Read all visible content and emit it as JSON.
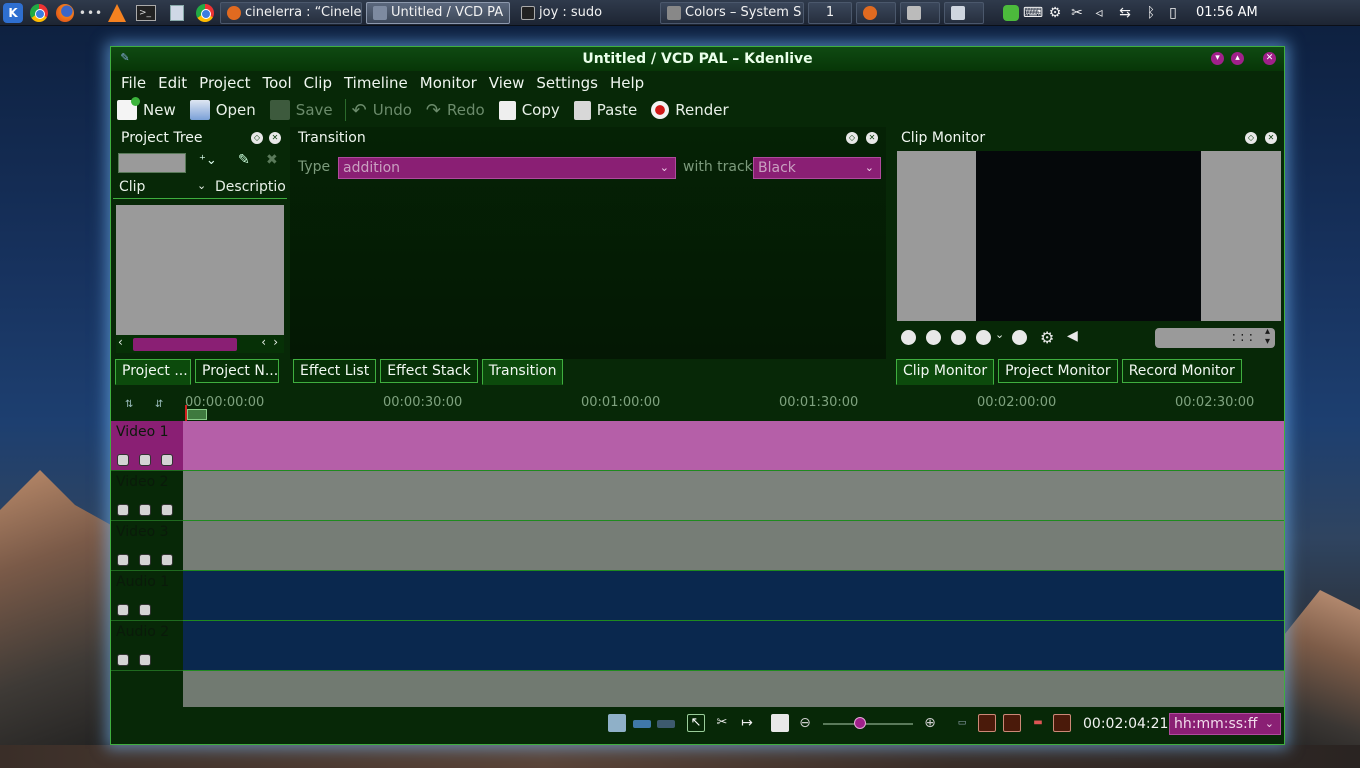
{
  "taskbar": {
    "tasks": [
      {
        "label": "cinelerra : “Cineler"
      },
      {
        "label": "Untitled / VCD PA"
      },
      {
        "label": "joy : sudo"
      },
      {
        "label": "Colors – System S"
      }
    ],
    "pager": "1",
    "clock": "01:56 AM"
  },
  "window": {
    "title": "Untitled / VCD PAL – Kdenlive",
    "menu": [
      "File",
      "Edit",
      "Project",
      "Tool",
      "Clip",
      "Timeline",
      "Monitor",
      "View",
      "Settings",
      "Help"
    ],
    "toolbar": {
      "new": "New",
      "open": "Open",
      "save": "Save",
      "undo": "Undo",
      "redo": "Redo",
      "copy": "Copy",
      "paste": "Paste",
      "render": "Render"
    }
  },
  "project_tree": {
    "title": "Project Tree",
    "col_clip": "Clip",
    "col_desc": "Descriptio"
  },
  "transition": {
    "title": "Transition",
    "type_label": "Type",
    "type_value": "addition",
    "with_track_label": "with track",
    "with_track_value": "Black"
  },
  "clip_monitor": {
    "title": "Clip Monitor",
    "timecode": ": : :"
  },
  "left_tabs": [
    "Project ...",
    "Project N..."
  ],
  "mid_tabs": [
    "Effect List",
    "Effect Stack",
    "Transition"
  ],
  "right_tabs": [
    "Clip Monitor",
    "Project Monitor",
    "Record Monitor"
  ],
  "timeline": {
    "ruler": [
      "00:00:00:00",
      "00:00:30:00",
      "00:01:00:00",
      "00:01:30:00",
      "00:02:00:00",
      "00:02:30:00"
    ],
    "tracks": [
      "Video 1",
      "Video 2",
      "Video 3",
      "Audio 1",
      "Audio 2"
    ],
    "zoom_level": 0.4
  },
  "status": {
    "timecode": "00:02:04:21",
    "format": "hh:mm:ss:ff"
  },
  "colors": {
    "window_bg": "#072807",
    "accent": "#a0208a",
    "border": "#3fae3f"
  }
}
